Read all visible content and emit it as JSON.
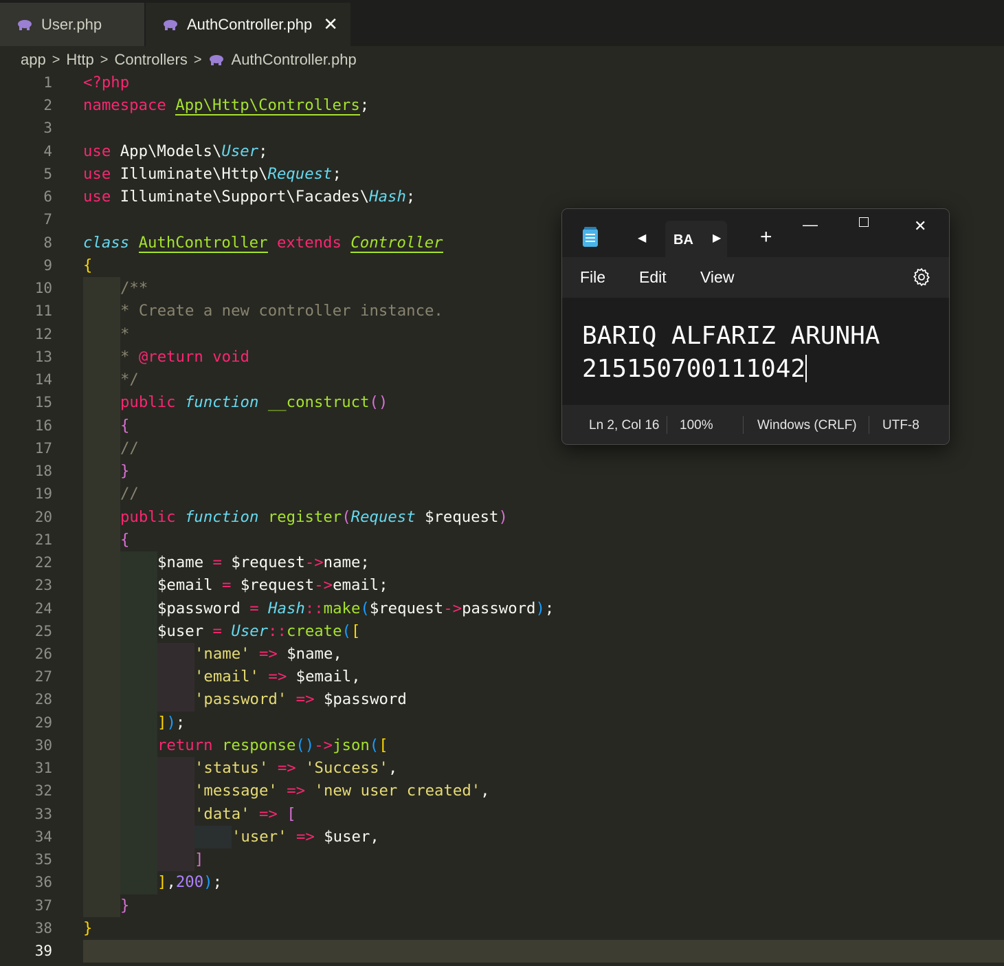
{
  "tabs": [
    {
      "label": "User.php",
      "active": false
    },
    {
      "label": "AuthController.php",
      "active": true
    }
  ],
  "breadcrumb": [
    "app",
    "Http",
    "Controllers",
    "AuthController.php"
  ],
  "line_numbers": [
    "1",
    "2",
    "3",
    "4",
    "5",
    "6",
    "7",
    "8",
    "9",
    "10",
    "11",
    "12",
    "13",
    "14",
    "15",
    "16",
    "17",
    "18",
    "19",
    "20",
    "21",
    "22",
    "23",
    "24",
    "25",
    "26",
    "27",
    "28",
    "29",
    "30",
    "31",
    "32",
    "33",
    "34",
    "35",
    "36",
    "37",
    "38",
    "39"
  ],
  "code": {
    "l1": {
      "a": "<?php"
    },
    "l2": {
      "a": "namespace",
      "b": "App\\Http\\Controllers",
      "c": ";"
    },
    "l4": {
      "a": "use",
      "b": "App\\Models\\",
      "c": "User",
      "d": ";"
    },
    "l5": {
      "a": "use",
      "b": "Illuminate\\Http\\",
      "c": "Request",
      "d": ";"
    },
    "l6": {
      "a": "use",
      "b": "Illuminate\\Support\\Facades\\",
      "c": "Hash",
      "d": ";"
    },
    "l8": {
      "a": "class",
      "b": "AuthController",
      "c": "extends",
      "d": "Controller"
    },
    "l9": {
      "a": "{"
    },
    "l10": {
      "a": "/**"
    },
    "l11": {
      "a": "* Create a new controller instance."
    },
    "l12": {
      "a": "*"
    },
    "l13": {
      "a": "* ",
      "b": "@return",
      "c": " void"
    },
    "l14": {
      "a": "*/"
    },
    "l15": {
      "a": "public",
      "b": "function",
      "c": "__construct",
      "d": "()"
    },
    "l16": {
      "a": "{"
    },
    "l17": {
      "a": "//"
    },
    "l18": {
      "a": "}"
    },
    "l19": {
      "a": "//"
    },
    "l20": {
      "a": "public",
      "b": "function",
      "c": "register",
      "d": "(",
      "e": "Request",
      "f": " $request",
      "g": ")"
    },
    "l21": {
      "a": "{"
    },
    "l22": {
      "a": "$name ",
      "b": "=",
      "c": " $request",
      "d": "->",
      "e": "name;"
    },
    "l23": {
      "a": "$email ",
      "b": "=",
      "c": " $request",
      "d": "->",
      "e": "email;"
    },
    "l24": {
      "a": "$password ",
      "b": "=",
      "c": " Hash",
      "d": "::",
      "e": "make",
      "f": "(",
      "g": "$request",
      "h": "->",
      "i": "password",
      "j": ")",
      "k": ";"
    },
    "l25": {
      "a": "$user ",
      "b": "=",
      "c": " User",
      "d": "::",
      "e": "create",
      "f": "(",
      "g": "["
    },
    "l26": {
      "a": "'name'",
      "b": " => ",
      "c": "$name,"
    },
    "l27": {
      "a": "'email'",
      "b": " => ",
      "c": "$email,"
    },
    "l28": {
      "a": "'password'",
      "b": " => ",
      "c": "$password"
    },
    "l29": {
      "a": "]",
      "b": ")",
      "c": ";"
    },
    "l30": {
      "a": "return",
      "b": " response",
      "c": "()",
      "d": "->",
      "e": "json",
      "f": "(",
      "g": "["
    },
    "l31": {
      "a": "'status'",
      "b": " => ",
      "c": "'Success'",
      "d": ","
    },
    "l32": {
      "a": "'message'",
      "b": " => ",
      "c": "'new user created'",
      "d": ","
    },
    "l33": {
      "a": "'data'",
      "b": " => ",
      "c": "["
    },
    "l34": {
      "a": "'user'",
      "b": " => ",
      "c": "$user,"
    },
    "l35": {
      "a": "]"
    },
    "l36": {
      "a": "]",
      "b": ",",
      "c": "200",
      "d": ")",
      "e": ";"
    },
    "l37": {
      "a": "}"
    },
    "l38": {
      "a": "}"
    }
  },
  "notepad": {
    "tab_label": "BA",
    "menu": [
      "File",
      "Edit",
      "View"
    ],
    "text_line1": "BARIQ ALFARIZ ARUNHA",
    "text_line2": "215150700111042",
    "status": {
      "position": "Ln 2, Col 16",
      "zoom": "100%",
      "line_ending": "Windows (CRLF)",
      "encoding": "UTF-8"
    }
  },
  "colors": {
    "editor_bg": "#272822",
    "keyword": "#f92672",
    "function": "#a6e22e",
    "type": "#66d9ef",
    "string": "#e6db74",
    "comment": "#88846f",
    "number": "#ae81ff"
  },
  "icons": [
    "php-elephant-icon",
    "close-icon",
    "chevron-right-icon",
    "notepad-icon",
    "arrow-left-icon",
    "arrow-right-icon",
    "plus-icon",
    "minimize-icon",
    "maximize-icon",
    "gear-icon"
  ]
}
